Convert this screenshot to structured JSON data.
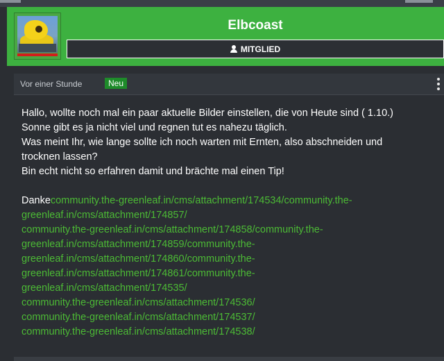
{
  "author": {
    "username": "Elbcoast",
    "rank": "MITGLIED"
  },
  "post": {
    "timestamp": "Vor einer Stunde",
    "badge": "Neu",
    "lines": [
      "Hallo, wollte noch mal ein paar aktuelle Bilder einstellen, die von Heute sind ( 1.10.)",
      "Sonne gibt es ja nicht viel und regnen tut es nahezu täglich.",
      "Was meint Ihr, wie lange sollte ich noch warten mit Ernten, also abschneiden und",
      "trocknen lassen?",
      "Bin echt nicht so erfahren damit und brächte mal einen Tip!"
    ],
    "closing": "Danke",
    "attachment_link_lines": [
      "community.the-greenleaf.in/cms/attachment/174534/community.the-",
      "greenleaf.in/cms/attachment/174857/",
      "community.the-greenleaf.in/cms/attachment/174858/community.the-",
      "greenleaf.in/cms/attachment/174859/community.the-",
      "greenleaf.in/cms/attachment/174860/community.the-",
      "greenleaf.in/cms/attachment/174861/community.the-",
      "greenleaf.in/cms/attachment/174535/",
      "community.the-greenleaf.in/cms/attachment/174536/",
      "community.the-greenleaf.in/cms/attachment/174537/",
      "community.the-greenleaf.in/cms/attachment/174538/"
    ]
  },
  "colors": {
    "accent_green": "#3db140",
    "link_green": "#4cbb35",
    "badge_green": "#1e8b2a",
    "status_red": "#d21c1c",
    "background": "#2b2e33"
  },
  "icons": {
    "rank": "user-icon",
    "menu": "vertical-dots-icon"
  }
}
